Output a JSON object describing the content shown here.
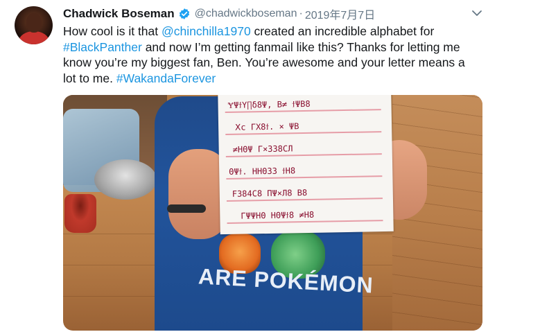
{
  "header": {
    "name": "Chadwick Boseman",
    "handle": "@chadwickboseman",
    "separator": "·",
    "date": "2019年7月7日"
  },
  "tweet": {
    "part1": "How cool is it that ",
    "mention": "@chinchilla1970",
    "part2": " created an incredible alphabet for ",
    "hashtag1": "#BlackPanther",
    "part3": " and now I’m getting fanmail like this? Thanks for letting me know you’re my biggest fan, Ben. You’re awesome and your letter means a lot to me. ",
    "hashtag2": "#WakandaForever"
  },
  "photo": {
    "shirt_text": "ARE POKÉMON",
    "letter_lines": [
      "ɎΨϯΥ∏δ8Ψ, B≠  ϯΨB8",
      "Ⅹc    ΓX8ϯ. ×  ΨB",
      "≠HΘΨ   Γ×338CЛ",
      "ΘΨϯ.  ΗΗΘ33   ϯΗ8",
      "F384C8  ΠΨ×Л8  B8",
      "ΓΨΨΗΘ   ΗΘΨϯ8  ≠Η8"
    ]
  },
  "colors": {
    "link": "#1b95e0",
    "secondary": "#657786",
    "verified": "#1da1f2"
  },
  "icons": {
    "verified": "verified-badge-icon",
    "caret": "chevron-down-icon"
  }
}
